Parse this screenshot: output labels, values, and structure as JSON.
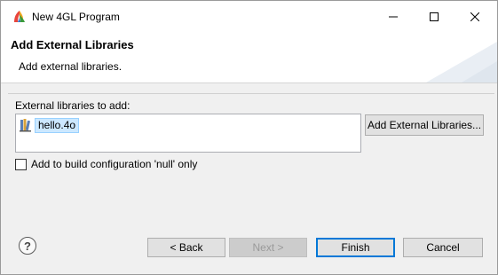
{
  "window": {
    "title": "New 4GL Program",
    "minimize_icon": "minimize-icon",
    "maximize_icon": "maximize-icon",
    "close_icon": "close-icon"
  },
  "header": {
    "title": "Add External Libraries",
    "description": "Add external libraries."
  },
  "libraries": {
    "label": "External libraries to add:",
    "items": [
      {
        "name": "hello.4o",
        "icon": "library-file-icon"
      }
    ],
    "add_button_label": "Add External Libraries..."
  },
  "options": {
    "add_to_build_label": "Add to build configuration 'null' only",
    "add_to_build_checked": false
  },
  "footer": {
    "help_icon": "help-icon",
    "back_label": "< Back",
    "next_label": "Next >",
    "finish_label": "Finish",
    "cancel_label": "Cancel"
  },
  "colors": {
    "accent": "#0078d7",
    "selection_bg": "#cce8ff"
  }
}
